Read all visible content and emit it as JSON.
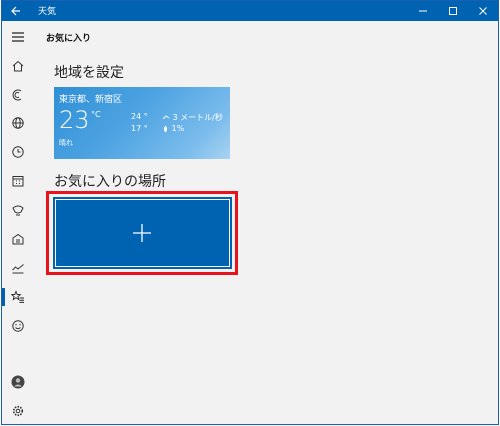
{
  "app": {
    "title": "天気"
  },
  "page": {
    "header": "お気に入り"
  },
  "sections": {
    "home_location_title": "地域を設定",
    "favorites_title": "お気に入りの場所"
  },
  "weather_card": {
    "location": "東京都、新宿区",
    "temperature": "23",
    "unit": "°C",
    "condition": "晴れ",
    "high": "24 °",
    "low": "17 °",
    "wind": "3 メートル/秒",
    "precipitation": "1%"
  },
  "sidebar": {
    "items": [
      {
        "icon": "hamburger-icon"
      },
      {
        "icon": "home-icon"
      },
      {
        "icon": "forecast-icon"
      },
      {
        "icon": "globe-icon"
      },
      {
        "icon": "clock-icon"
      },
      {
        "icon": "calendar-icon"
      },
      {
        "icon": "map-icon"
      },
      {
        "icon": "news-icon"
      },
      {
        "icon": "chart-icon"
      },
      {
        "icon": "favorites-icon",
        "active": true
      },
      {
        "icon": "smiley-icon"
      },
      {
        "icon": "account-icon"
      },
      {
        "icon": "settings-icon"
      }
    ]
  },
  "colors": {
    "accent": "#0063b1",
    "highlight": "#e8141d"
  }
}
